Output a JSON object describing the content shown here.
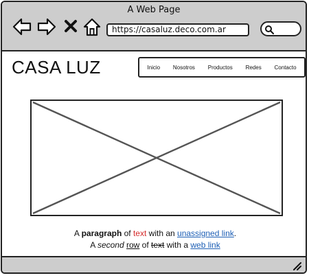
{
  "window": {
    "title": "A Web Page"
  },
  "toolbar": {
    "back_icon": "arrow-left-icon",
    "forward_icon": "arrow-right-icon",
    "stop_icon": "close-icon",
    "home_icon": "home-icon",
    "url": "https://casaluz.deco.com.ar",
    "search_icon": "search-icon"
  },
  "site": {
    "logo": "CASA LUZ",
    "menu": [
      "Inicio",
      "Nosotros",
      "Productos",
      "Redes",
      "Contacto"
    ]
  },
  "content": {
    "image_placeholder": "image-placeholder",
    "line1": {
      "a": "A ",
      "bold": "paragraph",
      "of": " of ",
      "red": "text",
      "with": " with an ",
      "link": "unassigned link",
      "end": "."
    },
    "line2": {
      "a": "A ",
      "italic": "second",
      "sp1": " ",
      "underlined": "row",
      "of": " of ",
      "strike": "text",
      "with": " with a ",
      "link": "web link"
    }
  },
  "colors": {
    "chrome": "#cdcdcd",
    "link": "#1d5fb5",
    "red_text": "#d42a2a",
    "stroke": "#222222"
  }
}
